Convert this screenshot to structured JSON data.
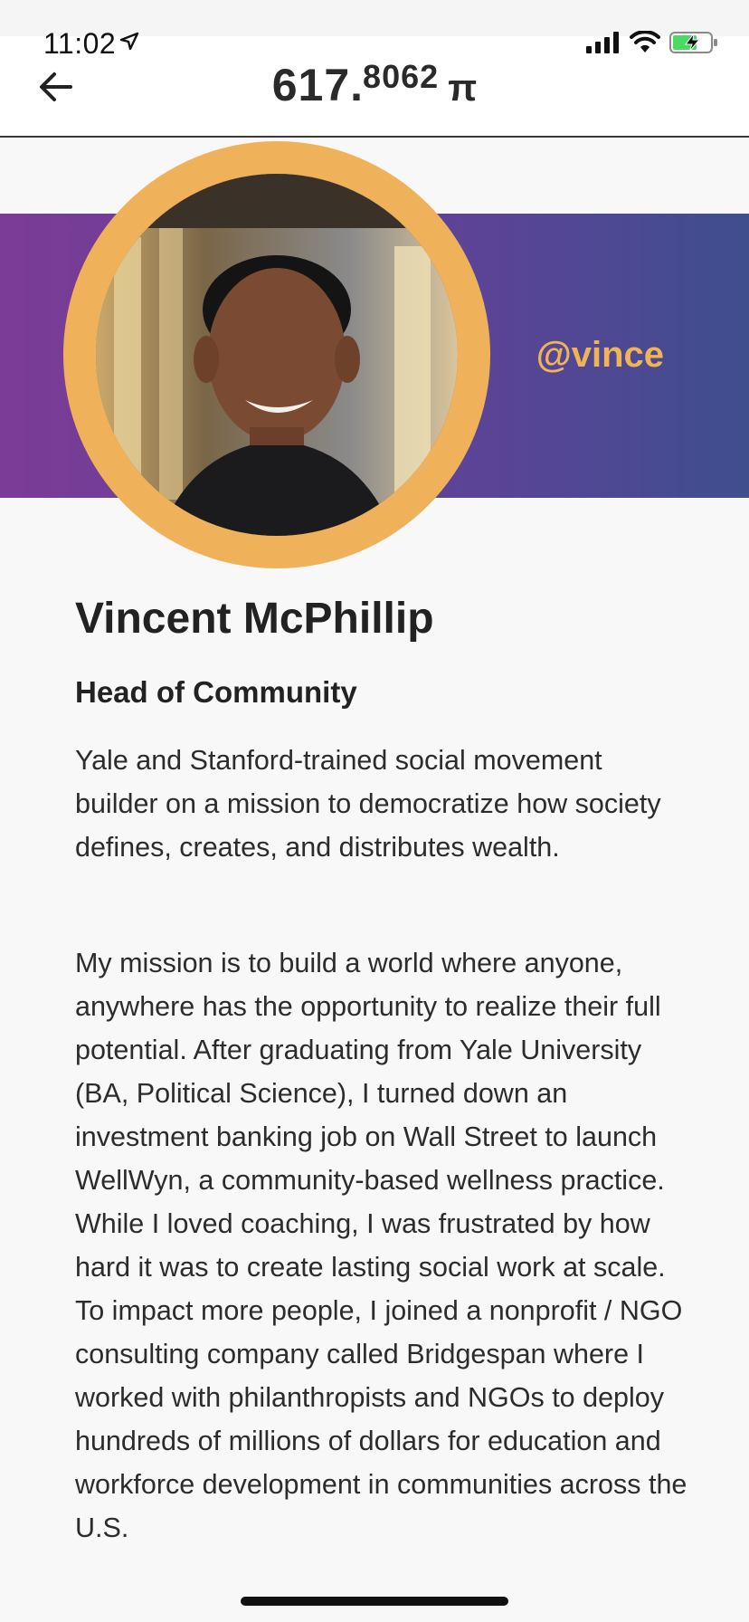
{
  "status_bar": {
    "time": "11:02",
    "location_icon": "location-arrow-icon",
    "signal_icon": "cellular-signal-icon",
    "wifi_icon": "wifi-icon",
    "battery_icon": "battery-charging-icon"
  },
  "header": {
    "back_icon": "back-arrow-icon",
    "balance_integer": "617",
    "balance_decimal": "8062",
    "currency_symbol": "π"
  },
  "profile": {
    "handle": "@vince",
    "name": "Vincent McPhillip",
    "role": "Head of Community",
    "bio_paragraphs": [
      "Yale and Stanford-trained social movement builder on a mission to democratize how society defines, creates, and distributes wealth.",
      "My mission is to build a world where anyone, anywhere has the opportunity to realize their full potential. After graduating from Yale University (BA, Political Science), I turned down an investment banking job on Wall Street to launch WellWyn, a community-based wellness practice. While I loved coaching, I was frustrated by how hard it was to create lasting social work at scale. To impact more people, I joined a nonprofit / NGO consulting company called Bridgespan where I worked with philanthropists and NGOs to deploy hundreds of millions of dollars for education and workforce development in communities across the U.S."
    ]
  },
  "colors": {
    "banner_start": "#7b3c96",
    "banner_end": "#3f4e8e",
    "accent_gold": "#efb25a",
    "text_dark": "#222222"
  }
}
